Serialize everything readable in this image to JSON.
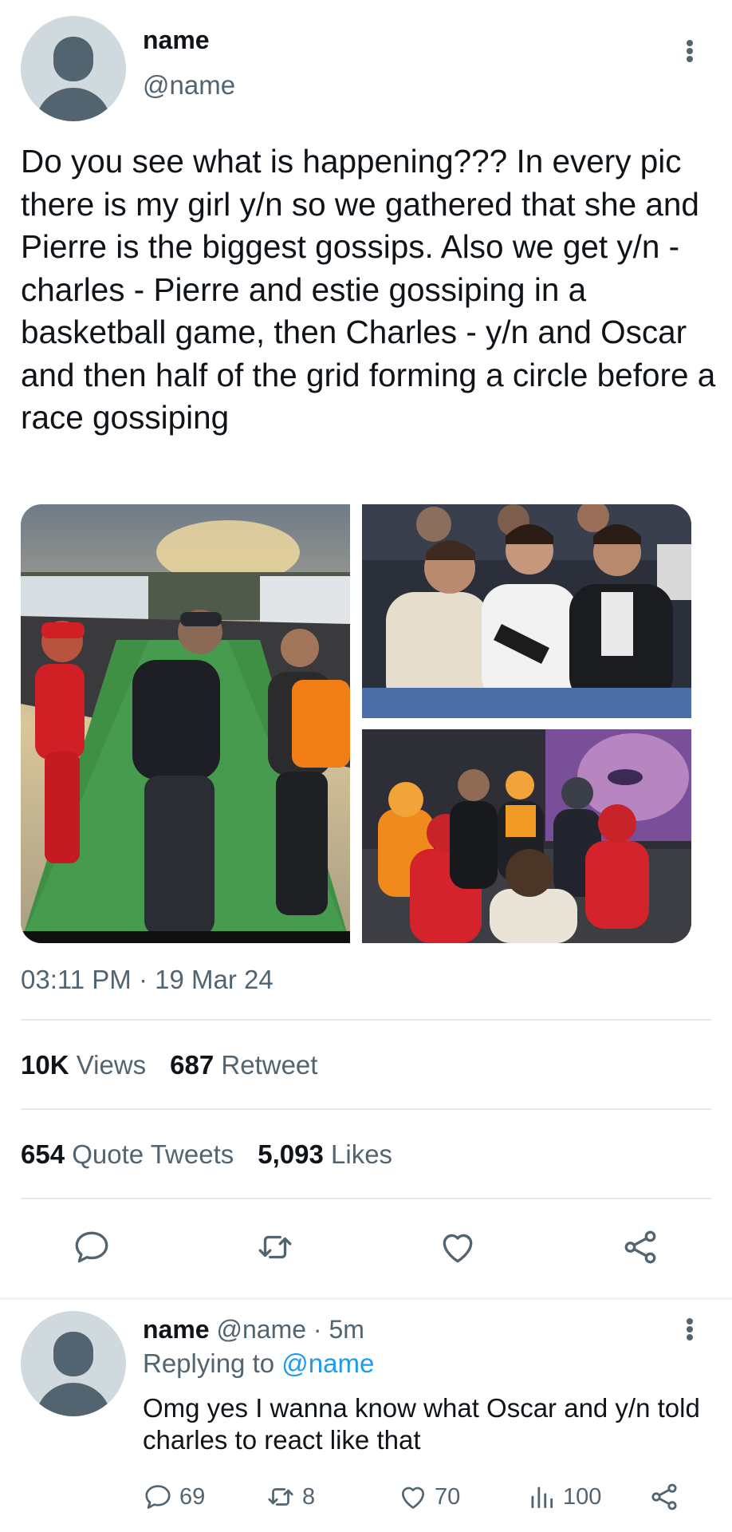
{
  "tweet": {
    "name": "name",
    "handle": "@name",
    "text": "Do you see what is happening??? In every pic there is my girl y/n so we gathered that she and Pierre is the biggest gossips. Also we get y/n - charles - Pierre and estie gossiping in a basketball game, then Charles - y/n and Oscar and then half of the grid forming a circle before a race gossiping",
    "timestamp": "03:11 PM · 19 Mar 24",
    "stats": {
      "views_count": "10K",
      "views_label": "Views",
      "retweets_count": "687",
      "retweets_label": "Retweet",
      "quotes_count": "654",
      "quotes_label": "Quote Tweets",
      "likes_count": "5,093",
      "likes_label": "Likes"
    },
    "actions": [
      "reply-icon",
      "retweet-icon",
      "like-icon",
      "share-icon"
    ]
  },
  "reply": {
    "name": "name",
    "handle": "@name",
    "time": "· 5m",
    "replying_prefix": "Replying to",
    "replying_to": "@name",
    "text": "Omg yes I wanna know what Oscar and y/n told charles to react like that",
    "replies": "69",
    "retweets": "8",
    "likes": "70",
    "views": "100"
  },
  "colors": {
    "text": "#0f1419",
    "secondary": "#536471",
    "link": "#1d9bf0",
    "divider": "#e7eaec",
    "avatar_bg": "#cfd9de"
  }
}
